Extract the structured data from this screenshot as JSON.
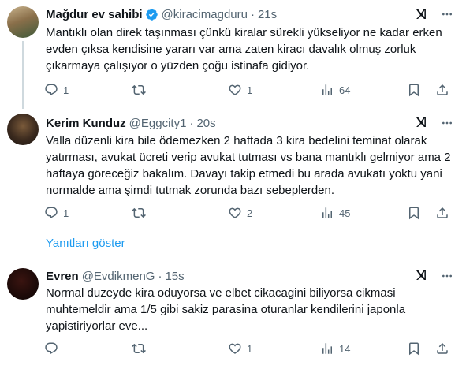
{
  "tweets": [
    {
      "name": "Mağdur ev sahibi",
      "handle": "@kiracimagduru",
      "time": "21s",
      "text": "Mantıklı olan direk taşınması çünkü kiralar sürekli yükseliyor ne kadar erken evden çıksa kendisine yararı var ama zaten kiracı davalık olmuş zorluk çıkarmaya çalışıyor o yüzden çoğu istinafa gidiyor.",
      "replies": "1",
      "retweets": "",
      "likes": "1",
      "views": "64"
    },
    {
      "name": "Kerim Kunduz",
      "handle": "@Eggcity1",
      "time": "20s",
      "text": "Valla düzenli kira bile ödemezken 2 haftada 3 kira bedelini teminat olarak yatırması, avukat ücreti verip avukat tutması vs bana mantıklı gelmiyor ama 2 haftaya göreceğiz bakalım. Davayı takip etmedi bu arada avukatı yoktu yani normalde ama şimdi tutmak zorunda bazı sebeplerden.",
      "replies": "1",
      "retweets": "",
      "likes": "2",
      "views": "45"
    },
    {
      "name": "Evren",
      "handle": "@EvdikmenG",
      "time": "15s",
      "text": "Normal duzeyde kira oduyorsa ve elbet cikacagini biliyorsa cikmasi muhtemeldir ama 1/5 gibi sakiz parasina oturanlar kendilerini japonla yapistiriyorlar eve...",
      "replies": "",
      "retweets": "",
      "likes": "1",
      "views": "14"
    }
  ],
  "show_replies_label": "Yanıtları göster",
  "colors": {
    "link": "#1d9bf0",
    "muted": "#536471",
    "verified": "#1d9bf0"
  }
}
